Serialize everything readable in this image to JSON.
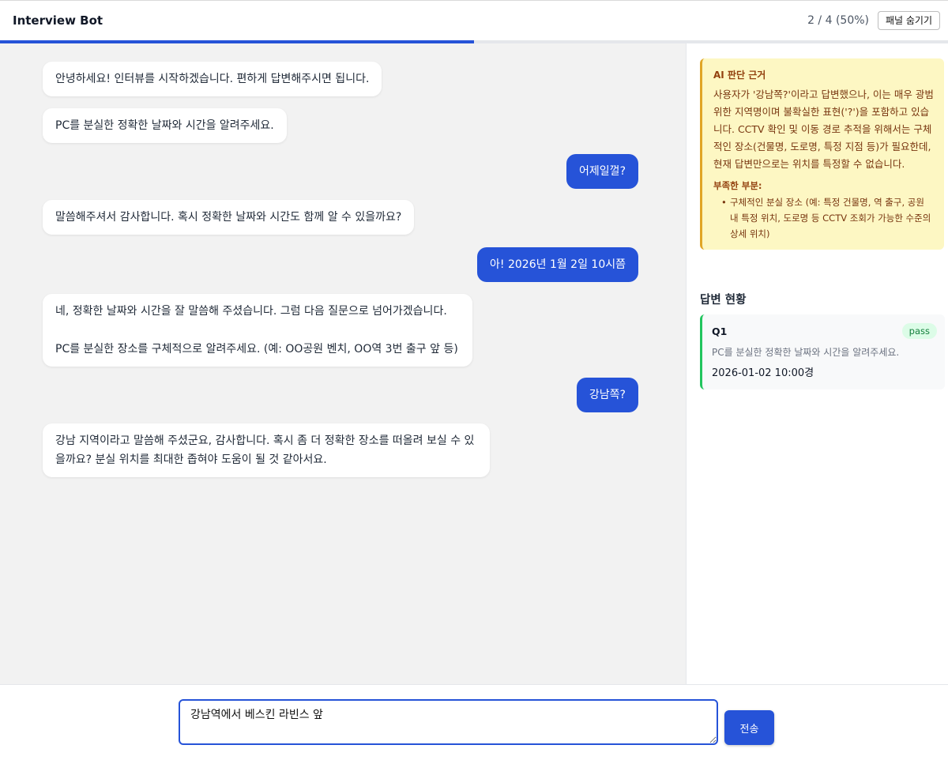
{
  "header": {
    "title": "Interview Bot",
    "progress_text": "2 / 4 (50%)",
    "progress_fraction": 0.5,
    "toggle_label": "패널 숨기기"
  },
  "messages": [
    {
      "role": "bot",
      "text": "안녕하세요! 인터뷰를 시작하겠습니다. 편하게 답변해주시면 됩니다."
    },
    {
      "role": "bot",
      "text": "PC를 분실한 정확한 날짜와 시간을 알려주세요."
    },
    {
      "role": "user",
      "text": "어제일껄?"
    },
    {
      "role": "bot",
      "text": "말씀해주셔서 감사합니다. 혹시 정확한 날짜와 시간도 함께 알 수 있을까요?"
    },
    {
      "role": "user",
      "text": "아! 2026년 1월 2일 10시쯤"
    },
    {
      "role": "bot",
      "text": "네, 정확한 날짜와 시간을 잘 말씀해 주셨습니다. 그럼 다음 질문으로 넘어가겠습니다.\n\nPC를 분실한 장소를 구체적으로 알려주세요. (예: OO공원 벤치, OO역 3번 출구 앞 등)"
    },
    {
      "role": "user",
      "text": "강남쪽?"
    },
    {
      "role": "bot",
      "text": "강남 지역이라고 말씀해 주셨군요, 감사합니다. 혹시 좀 더 정확한 장소를 떠올려 보실 수 있을까요? 분실 위치를 최대한 좁혀야 도움이 될 것 같아서요."
    }
  ],
  "panel": {
    "reason_title": "AI 판단 근거",
    "reason_text": "사용자가 '강남쪽?'이라고 답변했으나, 이는 매우 광범위한 지역명이며 불확실한 표현('?')을 포함하고 있습니다. CCTV 확인 및 이동 경로 추적을 위해서는 구체적인 장소(건물명, 도로명, 특정 지점 등)가 필요한데, 현재 답변만으로는 위치를 특정할 수 없습니다.",
    "missing_title": "부족한 부분:",
    "missing_items": [
      "구체적인 분실 장소 (예: 특정 건물명, 역 출구, 공원 내 특정 위치, 도로명 등 CCTV 조회가 가능한 수준의 상세 위치)"
    ],
    "status_heading": "답변 현황",
    "answers": [
      {
        "id": "Q1",
        "status": "pass",
        "question": "PC를 분실한 정확한 날짜와 시간을 알려주세요.",
        "answer": "2026-01-02 10:00경"
      }
    ]
  },
  "composer": {
    "input_value": "강남역에서 베스킨 라빈스 앞",
    "send_label": "전송"
  },
  "colors": {
    "accent": "#2653d8",
    "pass": "#22c55e",
    "warning_bg": "#fdf7c3",
    "warning_border": "#e0a526"
  }
}
